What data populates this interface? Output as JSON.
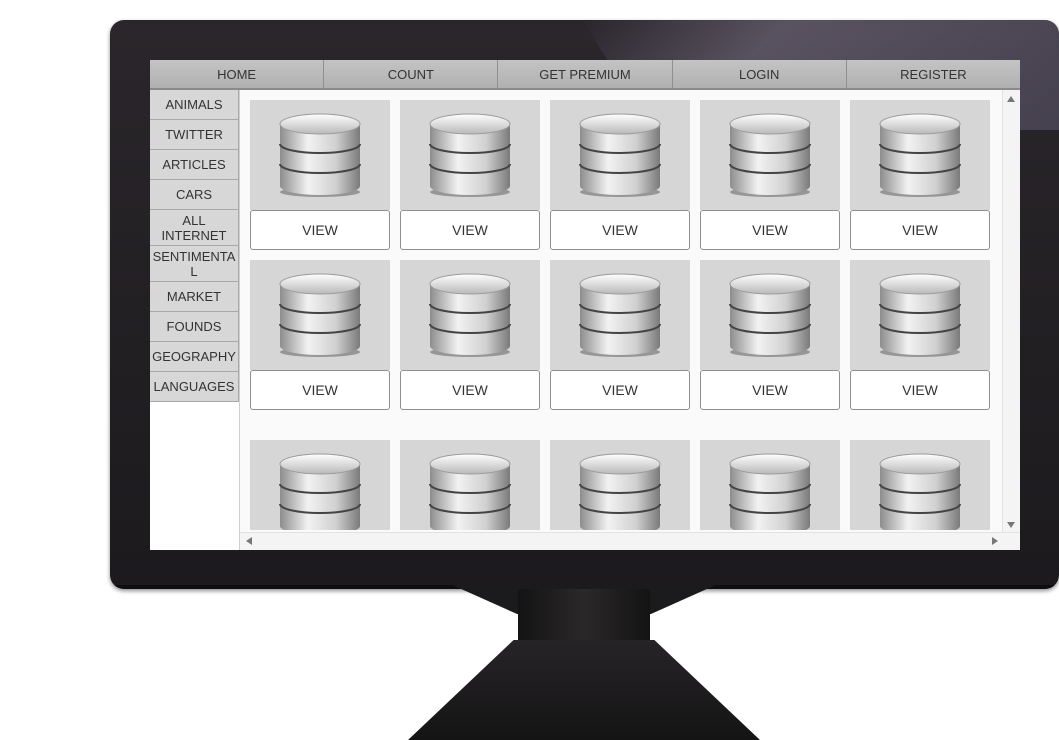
{
  "topnav": {
    "items": [
      {
        "label": "HOME"
      },
      {
        "label": "COUNT"
      },
      {
        "label": "GET PREMIUM"
      },
      {
        "label": "LOGIN"
      },
      {
        "label": "REGISTER"
      }
    ]
  },
  "sidebar": {
    "items": [
      {
        "label": "ANIMALS"
      },
      {
        "label": "TWITTER"
      },
      {
        "label": "ARTICLES"
      },
      {
        "label": "CARS"
      },
      {
        "label": "ALL INTERNET"
      },
      {
        "label": "SENTIMENTAL"
      },
      {
        "label": "MARKET"
      },
      {
        "label": "FOUNDS"
      },
      {
        "label": "GEOGRAPHY"
      },
      {
        "label": "LANGUAGES"
      }
    ]
  },
  "grid": {
    "card_icon": "database-icon",
    "view_label": "VIEW",
    "rows": 3,
    "columns": 5
  },
  "colors": {
    "nav_bg": "#b9b9b9",
    "sidebar_item_bg": "#d7d7d7",
    "thumb_bg": "#d6d6d6",
    "bezel": "#1f1d20"
  }
}
